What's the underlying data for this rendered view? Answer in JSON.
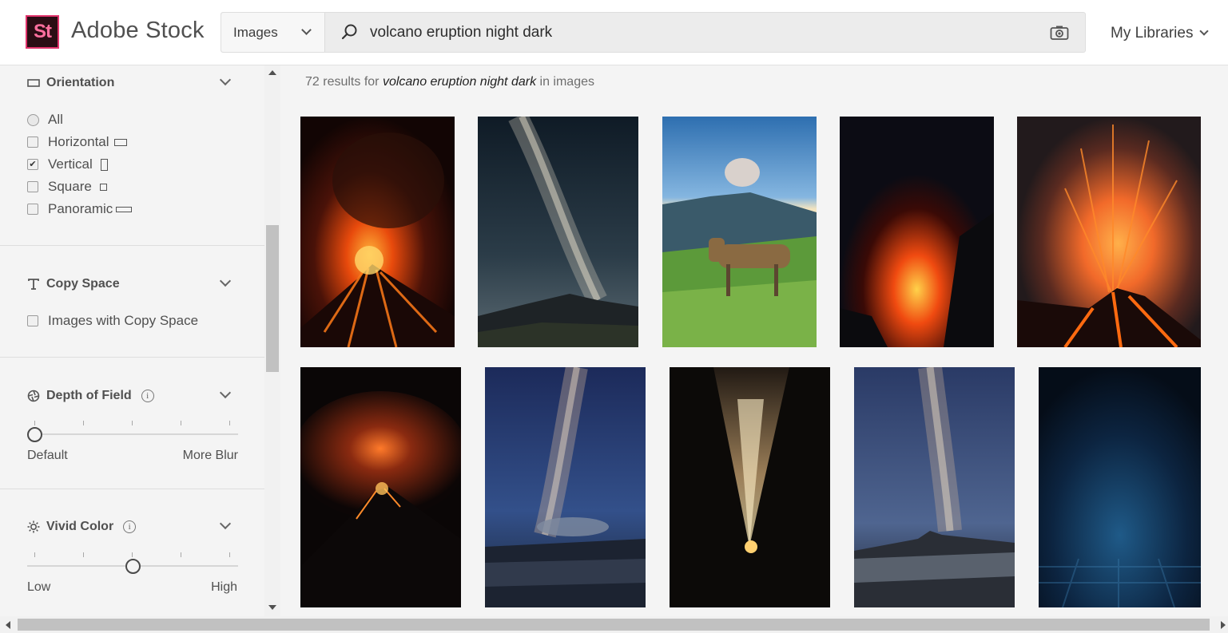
{
  "header": {
    "logo_text": "St",
    "brand": "Adobe Stock",
    "type_select": "Images",
    "search_value": "volcano eruption night dark",
    "my_libraries": "My Libraries"
  },
  "sidebar": {
    "orientation": {
      "title": "Orientation",
      "options": [
        {
          "label": "All",
          "type": "radio",
          "checked": false
        },
        {
          "label": "Horizontal",
          "type": "checkbox",
          "checked": false
        },
        {
          "label": "Vertical",
          "type": "checkbox",
          "checked": true
        },
        {
          "label": "Square",
          "type": "checkbox",
          "checked": false
        },
        {
          "label": "Panoramic",
          "type": "checkbox",
          "checked": false
        }
      ]
    },
    "copy_space": {
      "title": "Copy Space",
      "option": "Images with Copy Space"
    },
    "depth_of_field": {
      "title": "Depth of Field",
      "info": "i",
      "min_label": "Default",
      "max_label": "More Blur",
      "value_fraction": 0.0
    },
    "vivid_color": {
      "title": "Vivid Color",
      "info": "i",
      "min_label": "Low",
      "max_label": "High",
      "value_fraction": 0.5
    }
  },
  "main": {
    "results_count": "72 results for",
    "results_query": "volcano eruption night dark",
    "results_suffix": "in images",
    "images": [
      {
        "name": "volcano-lava-eruption-1"
      },
      {
        "name": "milky-way-over-mountains"
      },
      {
        "name": "horse-volcano-landscape"
      },
      {
        "name": "lava-fountain-night"
      },
      {
        "name": "stromboli-lava-explosion"
      },
      {
        "name": "volcano-glow-night"
      },
      {
        "name": "milky-way-bromo"
      },
      {
        "name": "firework-fountain"
      },
      {
        "name": "milky-way-bromo-2"
      },
      {
        "name": "blue-fog-dark"
      }
    ]
  },
  "colors": {
    "accent": "#e0336b",
    "logo_bg": "#2b0d14",
    "panel_bg": "#f4f4f4"
  }
}
